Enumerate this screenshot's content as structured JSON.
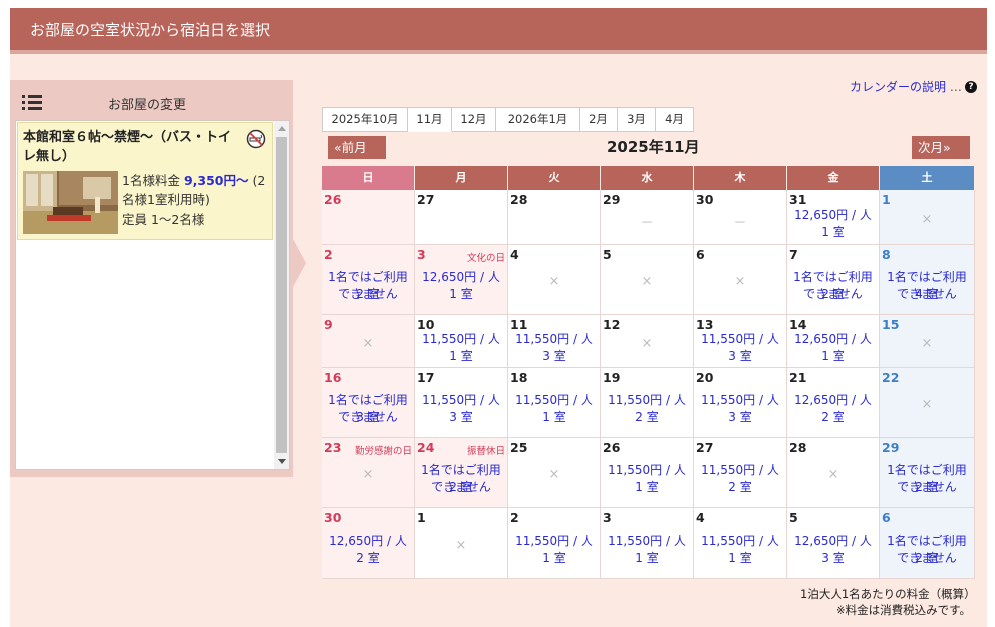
{
  "header": {
    "title": "お部屋の空室状況から宿泊日を選択"
  },
  "room_panel": {
    "change_label": "お部屋の変更",
    "room": {
      "name": "本館和室６帖～禁煙～（バス・トイレ無し）",
      "price_prefix": "1名様料金",
      "price": "9,350円～",
      "price_suffix": "(2名様1室利用時)",
      "capacity": "定員 1～2名様"
    }
  },
  "help": {
    "label": "カレンダーの説明",
    "dots": "…",
    "icon": "?"
  },
  "month_tabs": [
    {
      "label": "2025年10月",
      "active": false
    },
    {
      "label": "11月",
      "active": true
    },
    {
      "label": "12月",
      "active": false
    },
    {
      "label": "2026年1月",
      "active": false
    },
    {
      "label": "2月",
      "active": false
    },
    {
      "label": "3月",
      "active": false
    },
    {
      "label": "4月",
      "active": false
    }
  ],
  "nav": {
    "prev": "前月",
    "next": "次月",
    "current": "2025年11月"
  },
  "weekdays": [
    "日",
    "月",
    "火",
    "水",
    "木",
    "金",
    "土"
  ],
  "colors": {
    "header": "#b7645a",
    "sunday_header": "#d97a8d",
    "saturday_header": "#5b8dc4",
    "weekday_header": "#b7645a",
    "link": "#2a2ad0"
  },
  "calendar": [
    [
      {
        "day": "26",
        "mark": ""
      },
      {
        "day": "27",
        "mark": ""
      },
      {
        "day": "28",
        "mark": ""
      },
      {
        "day": "29",
        "mark": "－"
      },
      {
        "day": "30",
        "mark": "－"
      },
      {
        "day": "31",
        "price": "12,650円 / 人",
        "rooms": "1 室"
      },
      {
        "day": "1",
        "mark": "×"
      }
    ],
    [
      {
        "day": "2",
        "price": "1名ではご利用できません",
        "rooms": "2 室"
      },
      {
        "day": "3",
        "holiday": "文化の日",
        "price": "12,650円 / 人",
        "rooms": "1 室"
      },
      {
        "day": "4",
        "mark": "×"
      },
      {
        "day": "5",
        "mark": "×"
      },
      {
        "day": "6",
        "mark": "×"
      },
      {
        "day": "7",
        "price": "1名ではご利用できません",
        "rooms": "2 室"
      },
      {
        "day": "8",
        "price": "1名ではご利用できません",
        "rooms": "4 室"
      }
    ],
    [
      {
        "day": "9",
        "mark": "×"
      },
      {
        "day": "10",
        "price": "11,550円 / 人",
        "rooms": "1 室"
      },
      {
        "day": "11",
        "price": "11,550円 / 人",
        "rooms": "3 室"
      },
      {
        "day": "12",
        "mark": "×"
      },
      {
        "day": "13",
        "price": "11,550円 / 人",
        "rooms": "3 室"
      },
      {
        "day": "14",
        "price": "12,650円 / 人",
        "rooms": "1 室"
      },
      {
        "day": "15",
        "mark": "×"
      }
    ],
    [
      {
        "day": "16",
        "price": "1名ではご利用できません",
        "rooms": "3 室"
      },
      {
        "day": "17",
        "price": "11,550円 / 人",
        "rooms": "3 室"
      },
      {
        "day": "18",
        "price": "11,550円 / 人",
        "rooms": "1 室"
      },
      {
        "day": "19",
        "price": "11,550円 / 人",
        "rooms": "2 室"
      },
      {
        "day": "20",
        "price": "11,550円 / 人",
        "rooms": "3 室"
      },
      {
        "day": "21",
        "price": "12,650円 / 人",
        "rooms": "2 室"
      },
      {
        "day": "22",
        "mark": "×"
      }
    ],
    [
      {
        "day": "23",
        "holiday": "勤労感謝の日",
        "mark": "×"
      },
      {
        "day": "24",
        "holiday": "振替休日",
        "price": "1名ではご利用できません",
        "rooms": "2 室"
      },
      {
        "day": "25",
        "mark": "×"
      },
      {
        "day": "26",
        "price": "11,550円 / 人",
        "rooms": "1 室"
      },
      {
        "day": "27",
        "price": "11,550円 / 人",
        "rooms": "2 室"
      },
      {
        "day": "28",
        "mark": "×"
      },
      {
        "day": "29",
        "price": "1名ではご利用できません",
        "rooms": "2 室"
      }
    ],
    [
      {
        "day": "30",
        "price": "12,650円 / 人",
        "rooms": "2 室"
      },
      {
        "day": "1",
        "mark": "×"
      },
      {
        "day": "2",
        "price": "11,550円 / 人",
        "rooms": "1 室"
      },
      {
        "day": "3",
        "price": "11,550円 / 人",
        "rooms": "1 室"
      },
      {
        "day": "4",
        "price": "11,550円 / 人",
        "rooms": "1 室"
      },
      {
        "day": "5",
        "price": "12,650円 / 人",
        "rooms": "3 室"
      },
      {
        "day": "6",
        "price": "1名ではご利用できません",
        "rooms": "2 室"
      }
    ]
  ],
  "footnotes": [
    "1泊大人1名あたりの料金（概算）",
    "※料金は消費税込みです。"
  ]
}
